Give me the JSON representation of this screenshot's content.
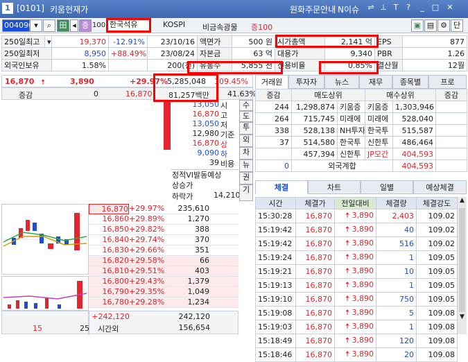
{
  "window": {
    "number": "1",
    "code": "[0101]",
    "title": "키움현재가",
    "menu1": "원화주문안내",
    "menu2": "N이슈"
  },
  "toolbar": {
    "code": "004090",
    "name": "한국석유",
    "market": "KOSPI",
    "sector": "비금속광물",
    "margin": "증100",
    "pct": "100",
    "tag": "증",
    "btn_end": "단"
  },
  "info": [
    {
      "label": "250일최고",
      "v1": "19,370",
      "v2": "-12.91%",
      "date": "23/10/16",
      "k2": "액면가",
      "v3": "500 원",
      "k3": "시가총액",
      "v4": "2,141 억",
      "k4": "EPS",
      "v5": "877"
    },
    {
      "label": "250일최저",
      "v1": "8,950",
      "v2": "+88.49%",
      "date": "23/08/24",
      "k2": "자본금",
      "v3": "63 억",
      "k3": "대용가",
      "v4": "9,340",
      "k4": "PBR",
      "v5": "1.26"
    },
    {
      "label": "외국인보유",
      "v1": "1.58%",
      "v2": "",
      "date": "200(천)",
      "k2": "유통수",
      "v3": "5,855 천",
      "k3": "신용비율",
      "v4": "0.85%",
      "k4": "결산월",
      "v5": "12월"
    }
  ],
  "price": {
    "current": "16,870",
    "change": "3,890",
    "rate": "+29.97%",
    "volume": "5,285,048",
    "vol_rate": "109.45%",
    "diff_label": "증감",
    "diff": "0",
    "price2": "16,870",
    "amount": "81,257백만",
    "ratio": "41.63%"
  },
  "summary": [
    {
      "v": "13,050",
      "k": "시"
    },
    {
      "v": "16,870",
      "k": "고"
    },
    {
      "v": "13,050",
      "k": "저"
    },
    {
      "v": "12,980",
      "k": "기준"
    },
    {
      "v": "16,870",
      "k": "상"
    },
    {
      "v": "9,090",
      "k": "하"
    },
    {
      "v": "39",
      "k": "비용"
    }
  ],
  "vi": {
    "title": "정적VI발동예상",
    "up": "상승가",
    "down": "하락가",
    "down_val": "14,210"
  },
  "side_buttons": [
    "수",
    "도",
    "투",
    "외",
    "차",
    "뉴",
    "권",
    "기"
  ],
  "orderbook": [
    {
      "p": "16,870",
      "r": "+29.97%",
      "q": "235,610"
    },
    {
      "p": "16,860",
      "r": "+29.89%",
      "q": "1,270"
    },
    {
      "p": "16,850",
      "r": "+29.82%",
      "q": "388"
    },
    {
      "p": "16,840",
      "r": "+29.74%",
      "q": "370"
    },
    {
      "p": "16,830",
      "r": "+29.66%",
      "q": "351"
    },
    {
      "p": "16,820",
      "r": "+29.58%",
      "q": "66"
    },
    {
      "p": "16,810",
      "r": "+29.51%",
      "q": "403"
    },
    {
      "p": "16,800",
      "r": "+29.43%",
      "q": "1,379"
    },
    {
      "p": "16,790",
      "r": "+29.35%",
      "q": "1,049"
    },
    {
      "p": "16,780",
      "r": "+29.28%",
      "q": "1,234"
    }
  ],
  "ob_bottom": {
    "change": "+242,120",
    "total": "242,120",
    "left1": "15",
    "left2": "25",
    "label": "시간외",
    "after": "156,654"
  },
  "broker_tabs": [
    "거래원",
    "투자자",
    "뉴스",
    "재무",
    "종목별",
    "프로"
  ],
  "broker_head": {
    "c1": "증감",
    "c2": "매도상위",
    "c3": "매수상위",
    "c4": "증감"
  },
  "brokers": [
    {
      "d": "244",
      "s": "1,298,874",
      "sn": "키움증",
      "bn": "키움증",
      "b": "1,303,946",
      "dd": ""
    },
    {
      "d": "264",
      "s": "715,745",
      "sn": "미래에",
      "bn": "미래에",
      "b": "528,040",
      "dd": ""
    },
    {
      "d": "338",
      "s": "528,138",
      "sn": "NH투자",
      "bn": "한국투",
      "b": "515,587",
      "dd": ""
    },
    {
      "d": "37",
      "s": "514,580",
      "sn": "한국투",
      "bn": "신한투",
      "b": "486,464",
      "dd": ""
    },
    {
      "d": "",
      "s": "457,394",
      "sn": "신한투",
      "bn": "JP모간",
      "b": "404,593",
      "dd": ""
    }
  ],
  "foreign": {
    "d": "0",
    "label": "외국계합",
    "b": "404,593"
  },
  "trade_tabs": [
    "체결",
    "차트",
    "일별",
    "예상체결"
  ],
  "trade_head": [
    "시간",
    "체결가",
    "전일대비",
    "체결량",
    "체결강도"
  ],
  "trades": [
    {
      "t": "15:30:28",
      "p": "16,870",
      "c": "3,890",
      "q": "2,403",
      "s": "109.02",
      "qc": "r"
    },
    {
      "t": "15:19:42",
      "p": "16,870",
      "c": "3,890",
      "q": "40",
      "s": "109.02",
      "qc": "b"
    },
    {
      "t": "15:19:42",
      "p": "16,870",
      "c": "3,890",
      "q": "516",
      "s": "109.02",
      "qc": "b"
    },
    {
      "t": "15:19:24",
      "p": "16,870",
      "c": "3,890",
      "q": "1",
      "s": "109.05",
      "qc": "b"
    },
    {
      "t": "15:19:21",
      "p": "16,870",
      "c": "3,890",
      "q": "10",
      "s": "109.05",
      "qc": "b"
    },
    {
      "t": "15:19:13",
      "p": "16,870",
      "c": "3,890",
      "q": "1",
      "s": "109.05",
      "qc": "b"
    },
    {
      "t": "15:19:10",
      "p": "16,870",
      "c": "3,890",
      "q": "750",
      "s": "109.05",
      "qc": "b"
    },
    {
      "t": "15:19:08",
      "p": "16,870",
      "c": "3,890",
      "q": "5",
      "s": "109.08",
      "qc": "b"
    },
    {
      "t": "15:19:03",
      "p": "16,870",
      "c": "3,890",
      "q": "1",
      "s": "109.08",
      "qc": "b"
    },
    {
      "t": "15:18:49",
      "p": "16,870",
      "c": "3,890",
      "q": "120",
      "s": "109.08",
      "qc": "b"
    },
    {
      "t": "15:18:46",
      "p": "16,870",
      "c": "3,890",
      "q": "20",
      "s": "109.08",
      "qc": "b"
    }
  ]
}
